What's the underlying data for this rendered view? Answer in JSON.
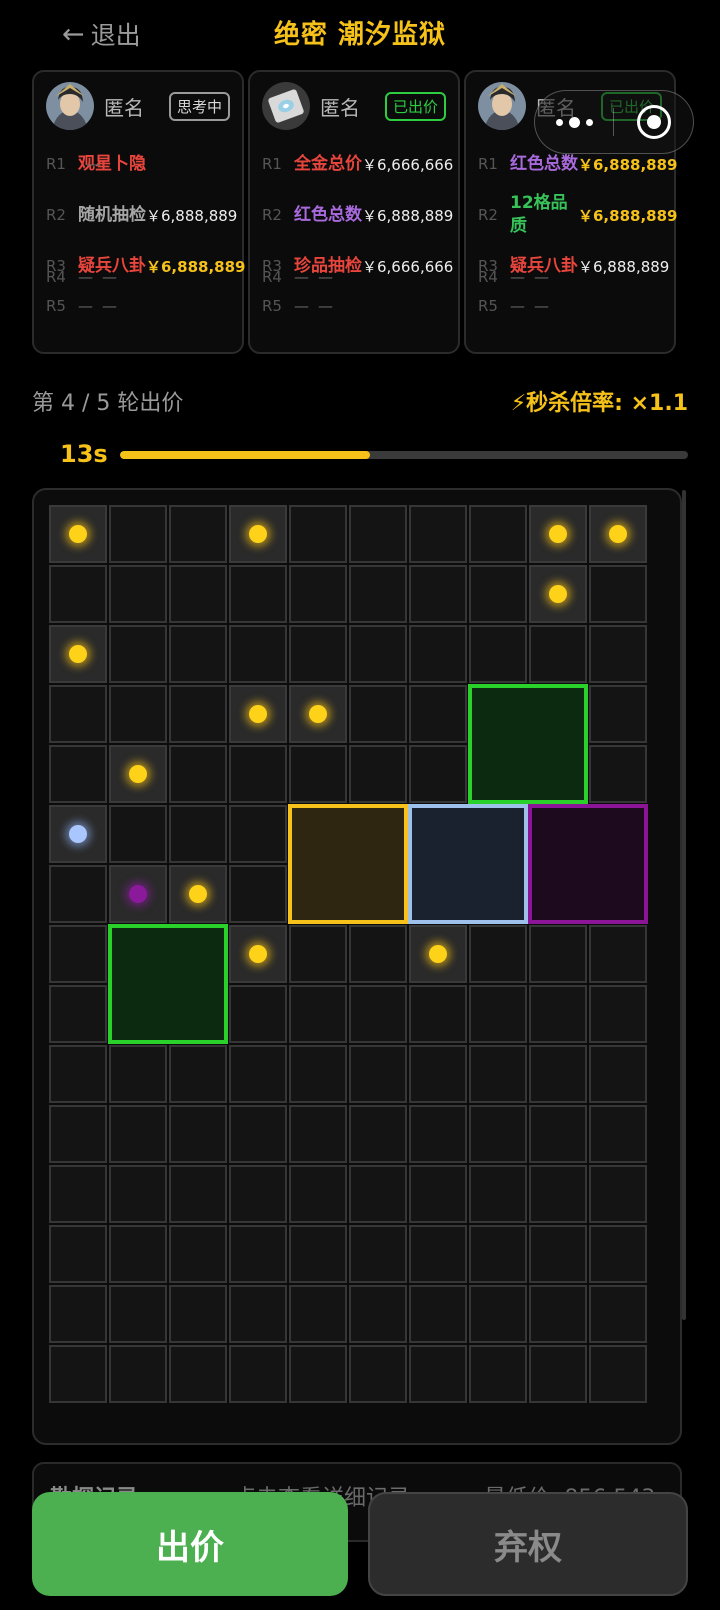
{
  "header": {
    "back_label": "退出",
    "title": "绝密 潮汐监狱"
  },
  "players": [
    {
      "name": "匿名",
      "status": "思考中",
      "avatar": "warrior-avatar",
      "rounds": [
        {
          "round": "R1",
          "label": "观星卜隐",
          "label_color": "red",
          "value": "—"
        },
        {
          "round": "R2",
          "label": "随机抽检",
          "label_color": "gray",
          "value": "￥6,888,889"
        },
        {
          "round": "R3",
          "label": "疑兵八卦",
          "label_color": "red",
          "value": "￥6,888,889",
          "value_highlight": true
        },
        {
          "round": "R4",
          "label": "—",
          "value": "—"
        },
        {
          "round": "R5",
          "label": "—",
          "value": "—"
        }
      ]
    },
    {
      "name": "匿名",
      "status": "已出价",
      "avatar": "disc-avatar",
      "rounds": [
        {
          "round": "R1",
          "label": "全金总价",
          "label_color": "red",
          "value": "￥6,666,666"
        },
        {
          "round": "R2",
          "label": "红色总数",
          "label_color": "purple",
          "value": "￥6,888,889"
        },
        {
          "round": "R3",
          "label": "珍品抽检",
          "label_color": "red",
          "value": "￥6,666,666"
        },
        {
          "round": "R4",
          "label": "—",
          "value": "—"
        },
        {
          "round": "R5",
          "label": "—",
          "value": "—"
        }
      ]
    },
    {
      "name": "匿名",
      "status": "已出价",
      "avatar": "warrior-avatar",
      "rounds": [
        {
          "round": "R1",
          "label": "红色总数",
          "label_color": "purple",
          "value": "￥6,888,889",
          "value_highlight": true
        },
        {
          "round": "R2",
          "label": "12格品质",
          "label_color": "green",
          "value": "￥6,888,889",
          "value_highlight": true
        },
        {
          "round": "R3",
          "label": "疑兵八卦",
          "label_color": "red",
          "value": "￥6,888,889"
        },
        {
          "round": "R4",
          "label": "—",
          "value": "—"
        },
        {
          "round": "R5",
          "label": "—",
          "value": "—"
        }
      ]
    }
  ],
  "round_info": {
    "text": "第 4 / 5 轮出价",
    "rate_text": "⚡秒杀倍率: ×1.1"
  },
  "timer": {
    "text": "13s",
    "progress": 0.44
  },
  "grid": {
    "cols": 10,
    "rows": 15,
    "lit_cells": [
      {
        "col": 0,
        "row": 0,
        "dot": "gold"
      },
      {
        "col": 3,
        "row": 0,
        "dot": "gold"
      },
      {
        "col": 8,
        "row": 0,
        "dot": "gold"
      },
      {
        "col": 9,
        "row": 0,
        "dot": "gold"
      },
      {
        "col": 8,
        "row": 1,
        "dot": "gold"
      },
      {
        "col": 0,
        "row": 2,
        "dot": "gold"
      },
      {
        "col": 3,
        "row": 3,
        "dot": "gold"
      },
      {
        "col": 4,
        "row": 3,
        "dot": "gold"
      },
      {
        "col": 1,
        "row": 4,
        "dot": "gold"
      },
      {
        "col": 0,
        "row": 5,
        "dot": "blue"
      },
      {
        "col": 1,
        "row": 6,
        "dot": "purple"
      },
      {
        "col": 2,
        "row": 6,
        "dot": "gold"
      },
      {
        "col": 3,
        "row": 7,
        "dot": "gold"
      },
      {
        "col": 6,
        "row": 7,
        "dot": "gold"
      }
    ],
    "items": [
      {
        "col": 7,
        "row": 3,
        "w": 2,
        "h": 2,
        "color": "green"
      },
      {
        "col": 4,
        "row": 5,
        "w": 2,
        "h": 2,
        "color": "yellow"
      },
      {
        "col": 6,
        "row": 5,
        "w": 2,
        "h": 2,
        "color": "blue"
      },
      {
        "col": 8,
        "row": 5,
        "w": 2,
        "h": 2,
        "color": "purple"
      },
      {
        "col": 1,
        "row": 7,
        "w": 2,
        "h": 2,
        "color": "green"
      }
    ]
  },
  "log": {
    "title": "勘探记录",
    "hint": "点击查看详细记录",
    "min_price": "最低价: 856,543"
  },
  "actions": {
    "bid_label": "出价",
    "abstain_label": "弃权"
  }
}
